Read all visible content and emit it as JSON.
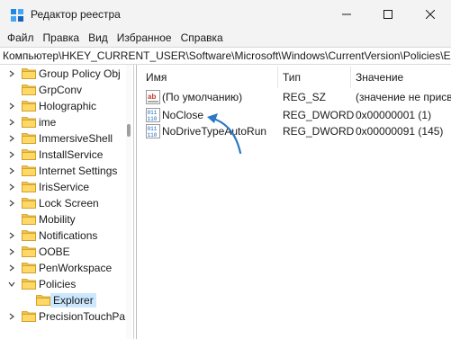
{
  "window": {
    "title": "Редактор реестра",
    "icon": "registry-editor-icon"
  },
  "menu": [
    "Файл",
    "Правка",
    "Вид",
    "Избранное",
    "Справка"
  ],
  "address": "Компьютер\\HKEY_CURRENT_USER\\Software\\Microsoft\\Windows\\CurrentVersion\\Policies\\Explorer",
  "tree": {
    "items": [
      {
        "label": "Group Policy Obj",
        "expandable": true
      },
      {
        "label": "GrpConv",
        "expandable": false
      },
      {
        "label": "Holographic",
        "expandable": true
      },
      {
        "label": "ime",
        "expandable": true
      },
      {
        "label": "ImmersiveShell",
        "expandable": true
      },
      {
        "label": "InstallService",
        "expandable": true
      },
      {
        "label": "Internet Settings",
        "expandable": true
      },
      {
        "label": "IrisService",
        "expandable": true
      },
      {
        "label": "Lock Screen",
        "expandable": true
      },
      {
        "label": "Mobility",
        "expandable": false
      },
      {
        "label": "Notifications",
        "expandable": true
      },
      {
        "label": "OOBE",
        "expandable": true
      },
      {
        "label": "PenWorkspace",
        "expandable": true
      },
      {
        "label": "Policies",
        "expandable": true,
        "expanded": true
      },
      {
        "label": "Explorer",
        "expandable": false,
        "selected": true
      },
      {
        "label": "PrecisionTouchPa",
        "expandable": true
      }
    ]
  },
  "values": {
    "columns": {
      "name": "Имя",
      "type": "Тип",
      "data": "Значение"
    },
    "rows": [
      {
        "icon": "string-value-icon",
        "name": "(По умолчанию)",
        "type": "REG_SZ",
        "data": "(значение не присвоено)"
      },
      {
        "icon": "dword-value-icon",
        "name": "NoClose",
        "type": "REG_DWORD",
        "data": "0x00000001 (1)"
      },
      {
        "icon": "dword-value-icon",
        "name": "NoDriveTypeAutoRun",
        "type": "REG_DWORD",
        "data": "0x00000091 (145)"
      }
    ]
  },
  "colors": {
    "selection": "#cce8ff",
    "folder": "#f2c24c",
    "arrow": "#2b78c5"
  }
}
